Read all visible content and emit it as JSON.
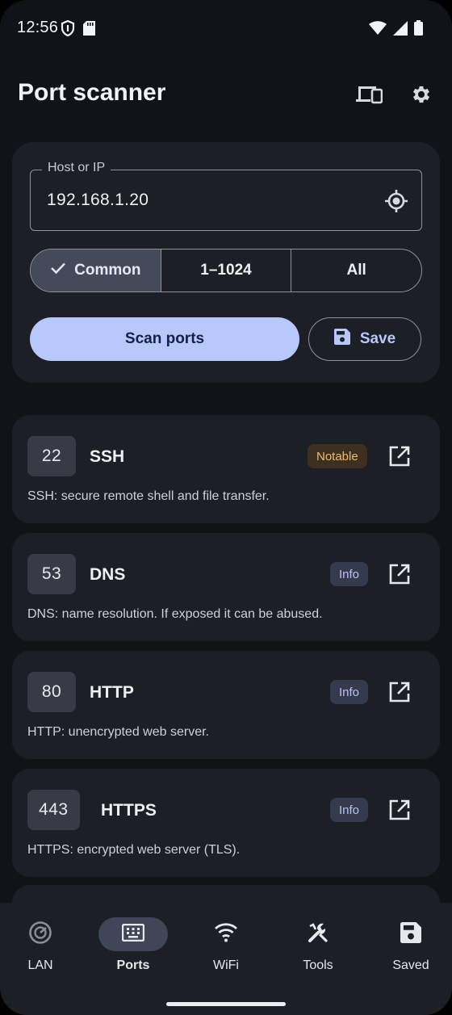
{
  "status_bar": {
    "time": "12:56",
    "left_icons": [
      "shield-icon",
      "sd-card-icon"
    ],
    "right_icons": [
      "wifi-icon",
      "signal-icon",
      "battery-icon"
    ]
  },
  "app_bar": {
    "title": "Port scanner",
    "actions": [
      "devices-icon",
      "settings-icon"
    ]
  },
  "scan_form": {
    "host_label": "Host or IP",
    "host_value": "192.168.1.20",
    "range_options": [
      {
        "label": "Common",
        "selected": true
      },
      {
        "label": "1–1024",
        "selected": false
      },
      {
        "label": "All",
        "selected": false
      }
    ],
    "scan_button": "Scan ports",
    "save_button": "Save"
  },
  "ports": [
    {
      "number": "22",
      "name": "SSH",
      "badge": "Notable",
      "badge_type": "notable",
      "description": "SSH: secure remote shell and file transfer."
    },
    {
      "number": "53",
      "name": "DNS",
      "badge": "Info",
      "badge_type": "info",
      "description": "DNS: name resolution. If exposed it can be abused."
    },
    {
      "number": "80",
      "name": "HTTP",
      "badge": "Info",
      "badge_type": "info",
      "description": "HTTP: unencrypted web server."
    },
    {
      "number": "443",
      "name": "HTTPS",
      "badge": "Info",
      "badge_type": "info",
      "description": "HTTPS: encrypted web server (TLS)."
    }
  ],
  "bottom_nav": [
    {
      "label": "LAN",
      "icon": "radar-icon",
      "active": false
    },
    {
      "label": "Ports",
      "icon": "keyboard-icon",
      "active": true
    },
    {
      "label": "WiFi",
      "icon": "wifi-icon",
      "active": false
    },
    {
      "label": "Tools",
      "icon": "wrench-icon",
      "active": false
    },
    {
      "label": "Saved",
      "icon": "save-icon",
      "active": false
    }
  ],
  "colors": {
    "background": "#121318",
    "surface": "#1d1f26",
    "primary_button": "#b9c8fb",
    "notable_badge": "#f1b869",
    "info_badge": "#b8c5ee"
  }
}
